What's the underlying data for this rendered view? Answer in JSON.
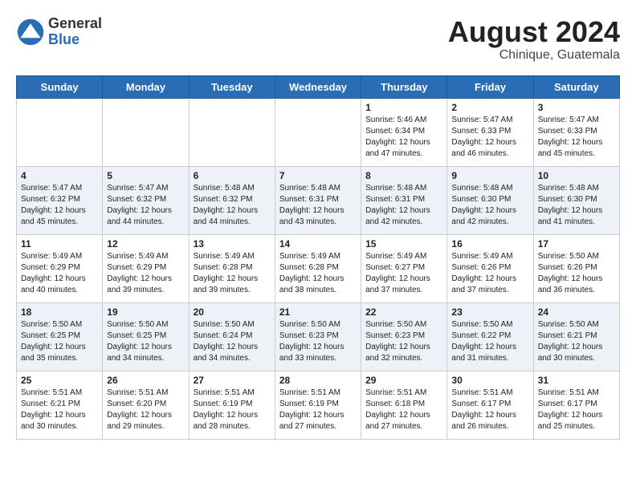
{
  "header": {
    "logo_general": "General",
    "logo_blue": "Blue",
    "month_year": "August 2024",
    "location": "Chinique, Guatemala"
  },
  "weekdays": [
    "Sunday",
    "Monday",
    "Tuesday",
    "Wednesday",
    "Thursday",
    "Friday",
    "Saturday"
  ],
  "weeks": [
    [
      {
        "day": "",
        "info": ""
      },
      {
        "day": "",
        "info": ""
      },
      {
        "day": "",
        "info": ""
      },
      {
        "day": "",
        "info": ""
      },
      {
        "day": "1",
        "info": "Sunrise: 5:46 AM\nSunset: 6:34 PM\nDaylight: 12 hours\nand 47 minutes."
      },
      {
        "day": "2",
        "info": "Sunrise: 5:47 AM\nSunset: 6:33 PM\nDaylight: 12 hours\nand 46 minutes."
      },
      {
        "day": "3",
        "info": "Sunrise: 5:47 AM\nSunset: 6:33 PM\nDaylight: 12 hours\nand 45 minutes."
      }
    ],
    [
      {
        "day": "4",
        "info": "Sunrise: 5:47 AM\nSunset: 6:32 PM\nDaylight: 12 hours\nand 45 minutes."
      },
      {
        "day": "5",
        "info": "Sunrise: 5:47 AM\nSunset: 6:32 PM\nDaylight: 12 hours\nand 44 minutes."
      },
      {
        "day": "6",
        "info": "Sunrise: 5:48 AM\nSunset: 6:32 PM\nDaylight: 12 hours\nand 44 minutes."
      },
      {
        "day": "7",
        "info": "Sunrise: 5:48 AM\nSunset: 6:31 PM\nDaylight: 12 hours\nand 43 minutes."
      },
      {
        "day": "8",
        "info": "Sunrise: 5:48 AM\nSunset: 6:31 PM\nDaylight: 12 hours\nand 42 minutes."
      },
      {
        "day": "9",
        "info": "Sunrise: 5:48 AM\nSunset: 6:30 PM\nDaylight: 12 hours\nand 42 minutes."
      },
      {
        "day": "10",
        "info": "Sunrise: 5:48 AM\nSunset: 6:30 PM\nDaylight: 12 hours\nand 41 minutes."
      }
    ],
    [
      {
        "day": "11",
        "info": "Sunrise: 5:49 AM\nSunset: 6:29 PM\nDaylight: 12 hours\nand 40 minutes."
      },
      {
        "day": "12",
        "info": "Sunrise: 5:49 AM\nSunset: 6:29 PM\nDaylight: 12 hours\nand 39 minutes."
      },
      {
        "day": "13",
        "info": "Sunrise: 5:49 AM\nSunset: 6:28 PM\nDaylight: 12 hours\nand 39 minutes."
      },
      {
        "day": "14",
        "info": "Sunrise: 5:49 AM\nSunset: 6:28 PM\nDaylight: 12 hours\nand 38 minutes."
      },
      {
        "day": "15",
        "info": "Sunrise: 5:49 AM\nSunset: 6:27 PM\nDaylight: 12 hours\nand 37 minutes."
      },
      {
        "day": "16",
        "info": "Sunrise: 5:49 AM\nSunset: 6:26 PM\nDaylight: 12 hours\nand 37 minutes."
      },
      {
        "day": "17",
        "info": "Sunrise: 5:50 AM\nSunset: 6:26 PM\nDaylight: 12 hours\nand 36 minutes."
      }
    ],
    [
      {
        "day": "18",
        "info": "Sunrise: 5:50 AM\nSunset: 6:25 PM\nDaylight: 12 hours\nand 35 minutes."
      },
      {
        "day": "19",
        "info": "Sunrise: 5:50 AM\nSunset: 6:25 PM\nDaylight: 12 hours\nand 34 minutes."
      },
      {
        "day": "20",
        "info": "Sunrise: 5:50 AM\nSunset: 6:24 PM\nDaylight: 12 hours\nand 34 minutes."
      },
      {
        "day": "21",
        "info": "Sunrise: 5:50 AM\nSunset: 6:23 PM\nDaylight: 12 hours\nand 33 minutes."
      },
      {
        "day": "22",
        "info": "Sunrise: 5:50 AM\nSunset: 6:23 PM\nDaylight: 12 hours\nand 32 minutes."
      },
      {
        "day": "23",
        "info": "Sunrise: 5:50 AM\nSunset: 6:22 PM\nDaylight: 12 hours\nand 31 minutes."
      },
      {
        "day": "24",
        "info": "Sunrise: 5:50 AM\nSunset: 6:21 PM\nDaylight: 12 hours\nand 30 minutes."
      }
    ],
    [
      {
        "day": "25",
        "info": "Sunrise: 5:51 AM\nSunset: 6:21 PM\nDaylight: 12 hours\nand 30 minutes."
      },
      {
        "day": "26",
        "info": "Sunrise: 5:51 AM\nSunset: 6:20 PM\nDaylight: 12 hours\nand 29 minutes."
      },
      {
        "day": "27",
        "info": "Sunrise: 5:51 AM\nSunset: 6:19 PM\nDaylight: 12 hours\nand 28 minutes."
      },
      {
        "day": "28",
        "info": "Sunrise: 5:51 AM\nSunset: 6:19 PM\nDaylight: 12 hours\nand 27 minutes."
      },
      {
        "day": "29",
        "info": "Sunrise: 5:51 AM\nSunset: 6:18 PM\nDaylight: 12 hours\nand 27 minutes."
      },
      {
        "day": "30",
        "info": "Sunrise: 5:51 AM\nSunset: 6:17 PM\nDaylight: 12 hours\nand 26 minutes."
      },
      {
        "day": "31",
        "info": "Sunrise: 5:51 AM\nSunset: 6:17 PM\nDaylight: 12 hours\nand 25 minutes."
      }
    ]
  ]
}
